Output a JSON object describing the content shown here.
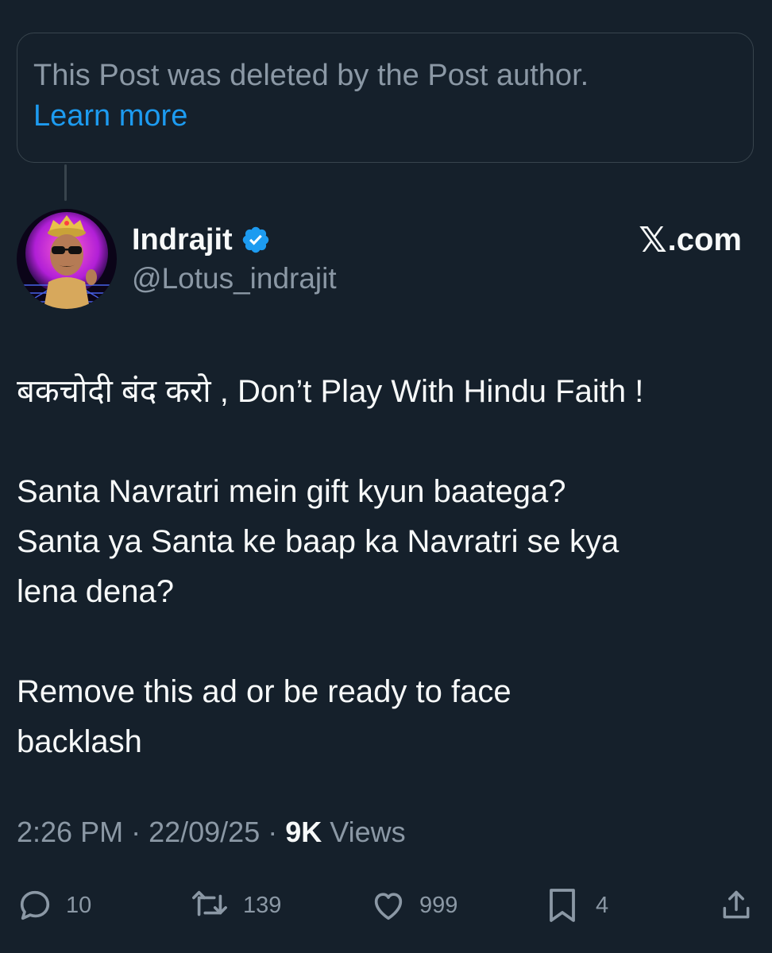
{
  "deleted_notice": {
    "text": "This Post was deleted by the Post author.",
    "link": "Learn more"
  },
  "author": {
    "name": "Indrajit",
    "handle": "@Lotus_indrajit",
    "verified": true,
    "avatar_icon": "avatar-image"
  },
  "brand": {
    "x_mark": "𝕏",
    "domain": ".com"
  },
  "post": {
    "line1": "बकचोदी बंद करो , Don’t Play With Hindu Faith !",
    "line2": "Santa Navratri mein gift kyun baatega?",
    "line3": "Santa ya Santa ke baap ka Navratri se kya",
    "line4": "lena dena?",
    "line5": "Remove this ad or be ready to face",
    "line6": "backlash"
  },
  "meta": {
    "time": "2:26 PM",
    "sep1": " · ",
    "date": "22/09/25",
    "sep2": " · ",
    "views_count": "9K",
    "views_label": " Views"
  },
  "actions": {
    "replies": "10",
    "reposts": "139",
    "likes": "999",
    "bookmarks": "4"
  },
  "colors": {
    "background": "#15202b",
    "accent": "#1d9bf0",
    "muted": "#8b98a5",
    "text": "#f7f9f9",
    "border": "#38444d"
  }
}
